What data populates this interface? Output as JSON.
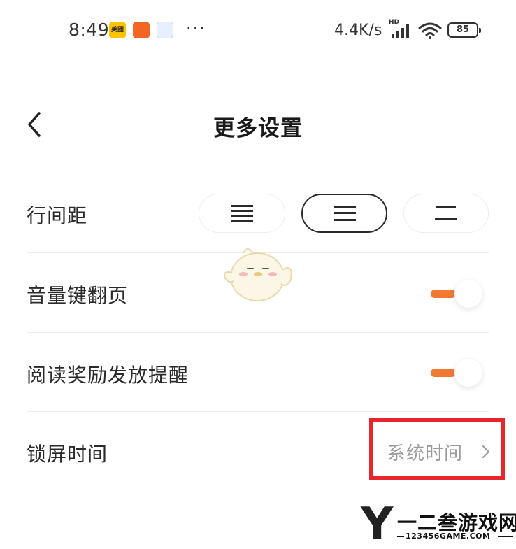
{
  "status_bar": {
    "time": "8:49",
    "meituan_text": "美团",
    "dots": "···",
    "network_speed": "4.4K/s",
    "hd": "HD",
    "battery": "85"
  },
  "header": {
    "title": "更多设置",
    "back_icon": "chevron-left-icon"
  },
  "settings": {
    "line_spacing": {
      "label": "行间距",
      "options": [
        "dense-lines-icon",
        "medium-lines-icon",
        "wide-lines-icon"
      ],
      "selected_index": 1
    },
    "volume_key_page": {
      "label": "音量键翻页",
      "enabled": true
    },
    "reading_reward_reminder": {
      "label": "阅读奖励发放提醒",
      "enabled": true
    },
    "lock_screen_time": {
      "label": "锁屏时间",
      "value": "系统时间"
    }
  },
  "watermark": {
    "letter": "Y",
    "name": "一二叁游戏网",
    "url": "123456GAME.COM"
  },
  "colors": {
    "accent": "#f07a33",
    "highlight": "#e8252b",
    "text_primary": "#2a2a2a",
    "text_secondary": "#9a9a9a"
  }
}
